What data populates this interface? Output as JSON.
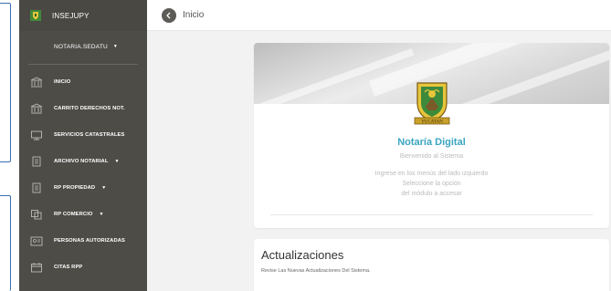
{
  "app": {
    "brand_name": "INSEJUPY"
  },
  "user": {
    "name": "NOTARIA.SEDATU"
  },
  "sidebar": {
    "items": [
      {
        "label": "INICIO",
        "icon": "bank-icon",
        "has_caret": false
      },
      {
        "label": "CARRITO DERECHOS NOT.",
        "icon": "bank-icon",
        "has_caret": false
      },
      {
        "label": "SERVICIOS CATASTRALES",
        "icon": "monitor-icon",
        "has_caret": false
      },
      {
        "label": "ARCHIVO NOTARIAL",
        "icon": "document-icon",
        "has_caret": true
      },
      {
        "label": "RP PROPIEDAD",
        "icon": "document-icon",
        "has_caret": true
      },
      {
        "label": "RP COMERCIO",
        "icon": "copy-icon",
        "has_caret": true
      },
      {
        "label": "PERSONAS AUTORIZADAS",
        "icon": "id-card-icon",
        "has_caret": false
      },
      {
        "label": "CITAS RPP",
        "icon": "calendar-icon",
        "has_caret": false
      }
    ]
  },
  "topbar": {
    "title": "Inicio"
  },
  "welcome": {
    "crest_text": "YUCATAN",
    "title": "Notaría Digital",
    "subtitle": "Bienvenido al Sistema",
    "lines": [
      "Ingrese en los menús del lado izquierdo",
      "Seleccione la opción",
      "del módulo a accesar"
    ]
  },
  "updates": {
    "title": "Actualizaciones",
    "description": "Revise Las Nuevas Actualizaciones Del Sistema."
  },
  "colors": {
    "sidebar_bg": "#4e4c47",
    "accent_title": "#3aa5c0",
    "page_bg": "#f2f2f2",
    "annotation_blue": "#3a6fb3"
  }
}
